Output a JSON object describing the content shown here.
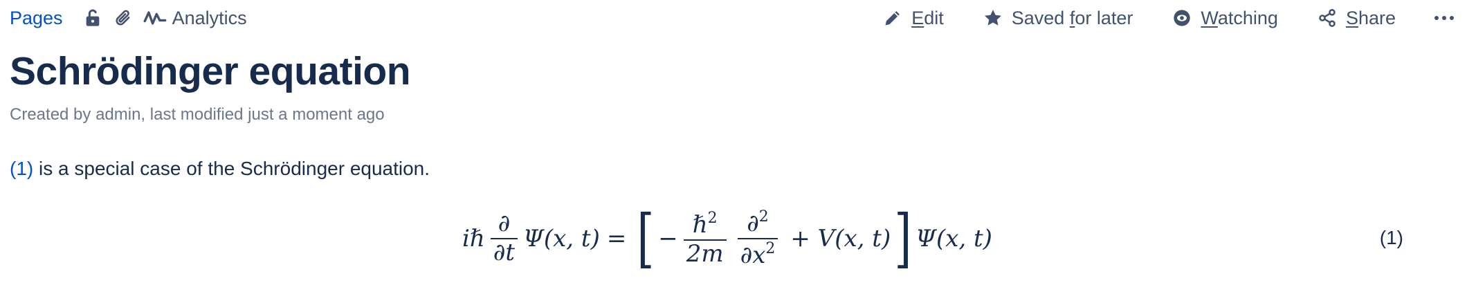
{
  "toolbar": {
    "pages_label": "Pages",
    "analytics_label": "Analytics",
    "actions": {
      "edit": {
        "prefix": "",
        "underline": "E",
        "suffix": "dit"
      },
      "saved": {
        "prefix": "Saved ",
        "underline": "f",
        "suffix": "or later"
      },
      "watching": {
        "prefix": "",
        "underline": "W",
        "suffix": "atching"
      },
      "share": {
        "prefix": "",
        "underline": "S",
        "suffix": "hare"
      }
    }
  },
  "page": {
    "title": "Schrödinger equation",
    "meta": "Created by admin, last modified just a moment ago",
    "paragraph": {
      "link": "(1)",
      "text": " is a special case of the Schrödinger equation."
    }
  },
  "equation": {
    "lhs_coeff": "iℏ",
    "d_num": "∂",
    "d_den": "∂t",
    "psi": "Ψ(x, t)",
    "equals": "=",
    "minus": "−",
    "hbar_num": "ℏ",
    "hbar_pow": "2",
    "hbar_den": "2m",
    "d2_num": "∂",
    "d2_num_pow": "2",
    "d2_den": "∂x",
    "d2_den_pow": "2",
    "plus_v": "+ V(x, t)",
    "rhs_psi": "Ψ(x, t)",
    "number": "(1)"
  },
  "colors": {
    "link": "#0052cc",
    "text": "#172b4d",
    "muted": "#6b778c",
    "icon": "#42526e"
  }
}
